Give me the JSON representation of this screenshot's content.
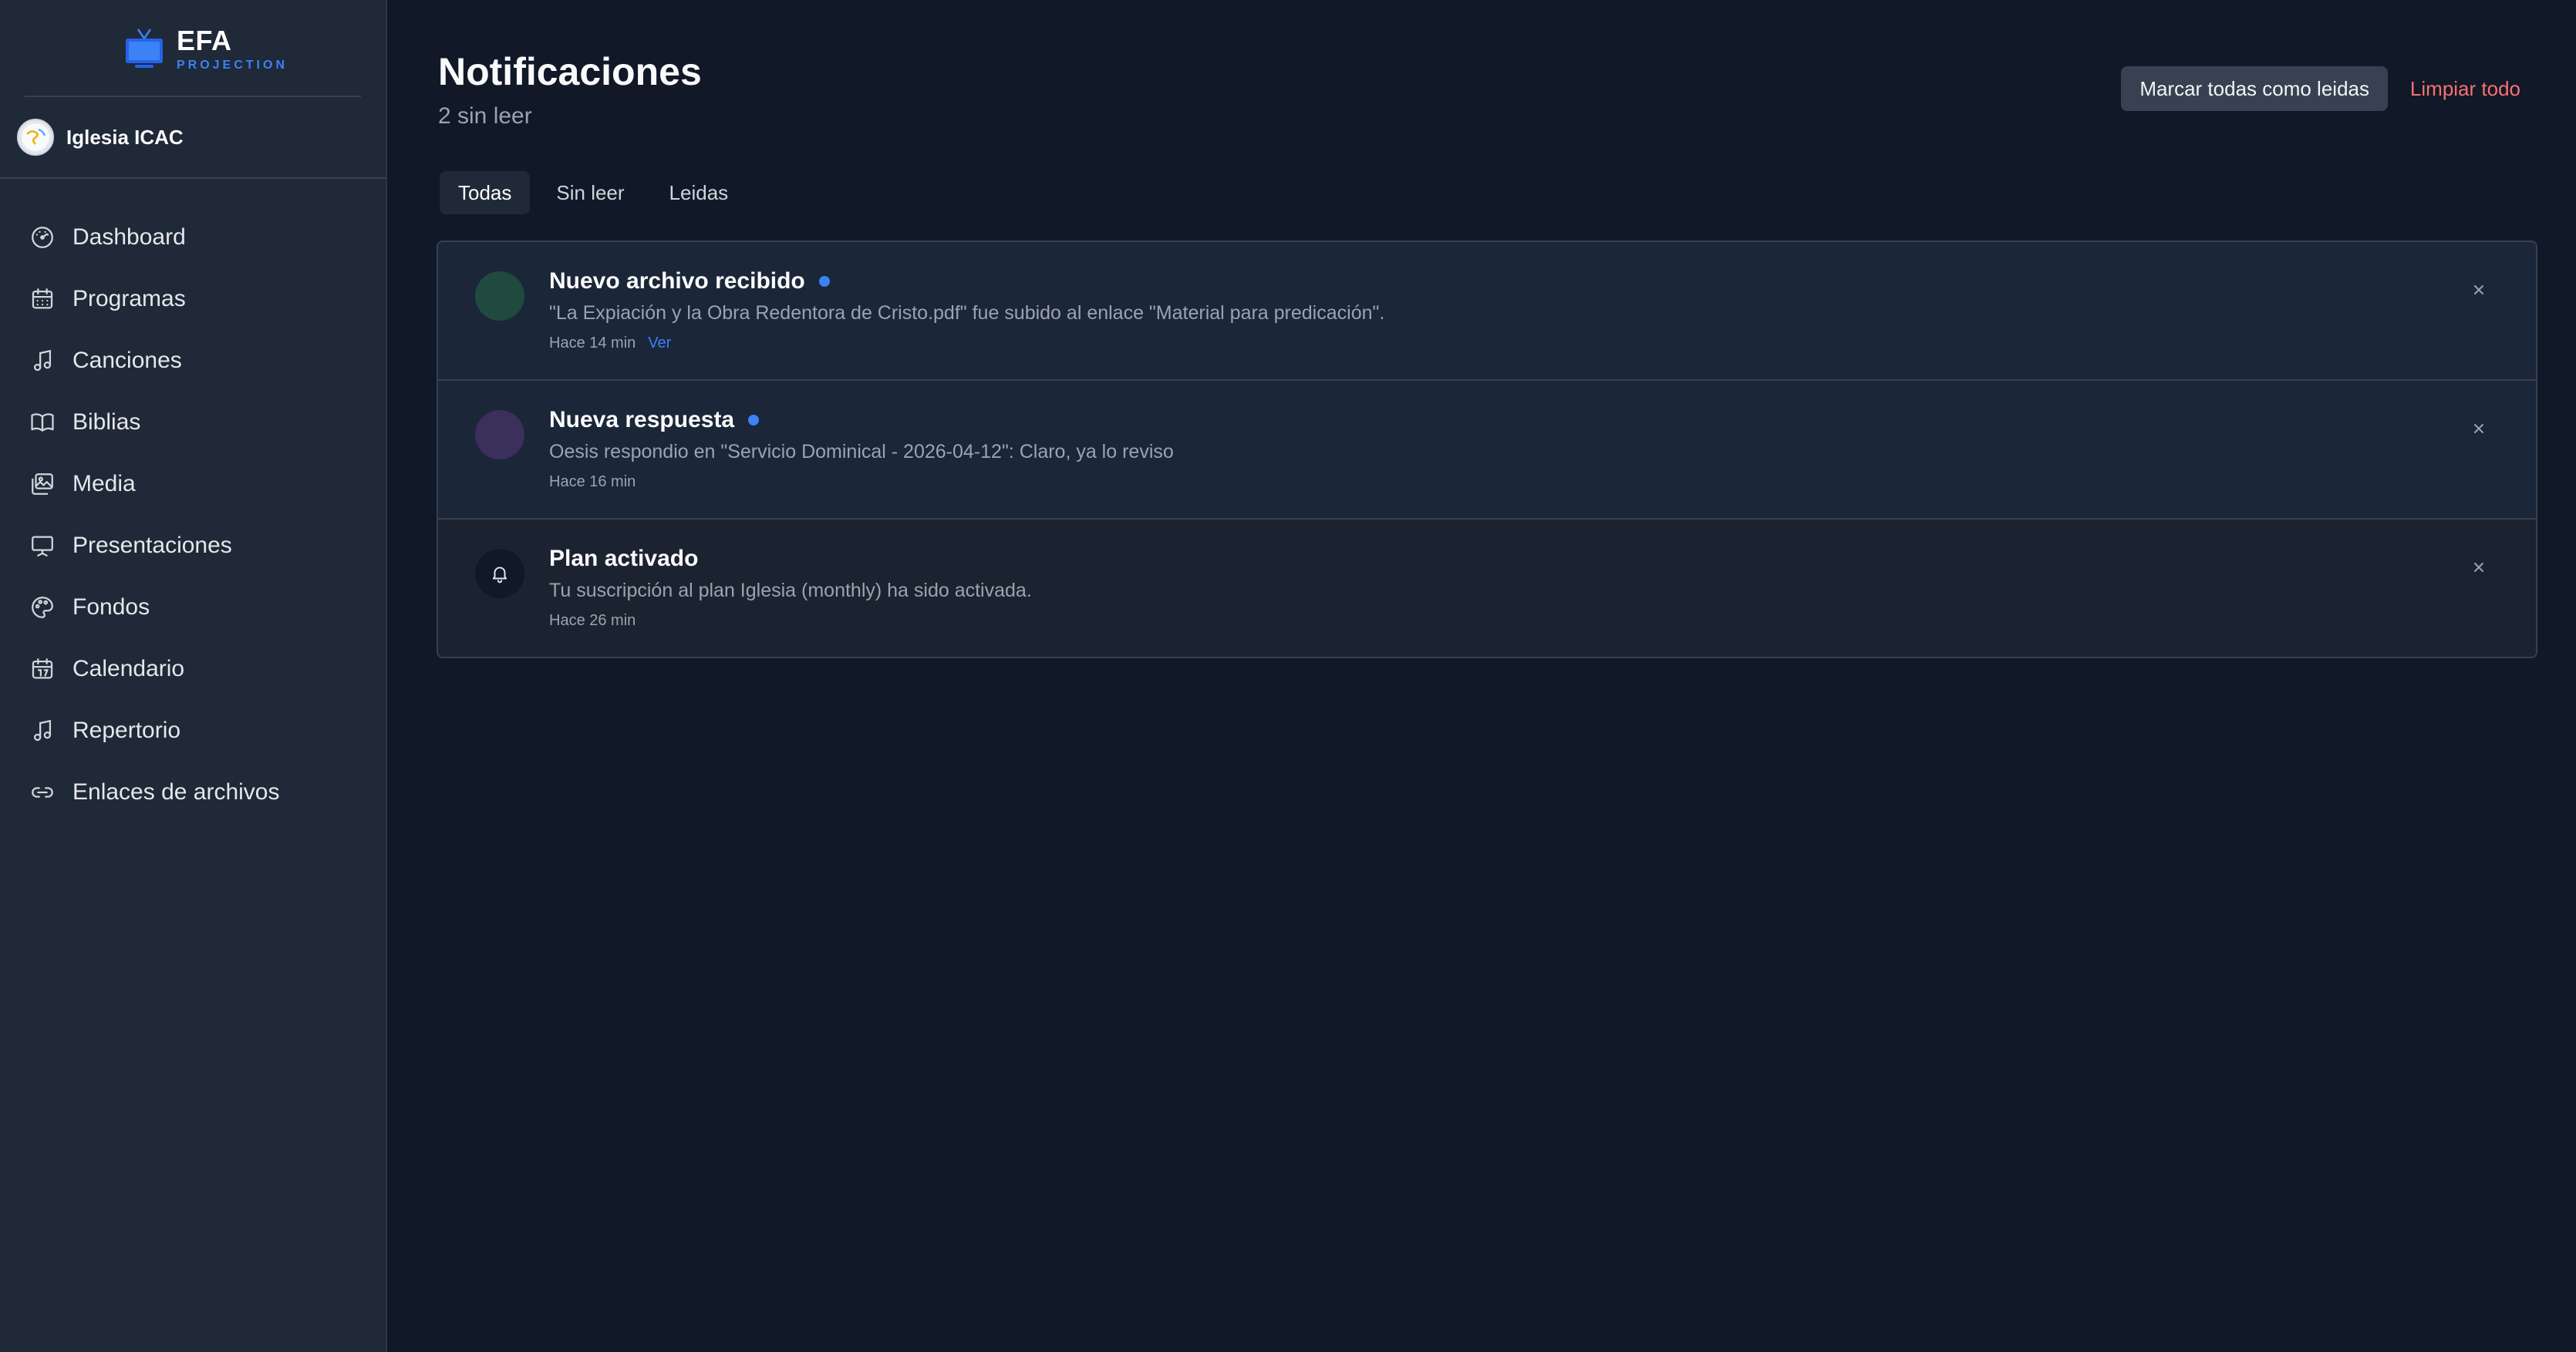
{
  "brand": {
    "name": "EFA",
    "sub": "PROJECTION"
  },
  "org": {
    "name": "Iglesia ICAC"
  },
  "nav": [
    {
      "label": "Dashboard",
      "icon": "gauge-icon"
    },
    {
      "label": "Programas",
      "icon": "calendar-grid-icon"
    },
    {
      "label": "Canciones",
      "icon": "music-note-icon"
    },
    {
      "label": "Biblias",
      "icon": "book-icon"
    },
    {
      "label": "Media",
      "icon": "images-icon"
    },
    {
      "label": "Presentaciones",
      "icon": "presentation-icon"
    },
    {
      "label": "Fondos",
      "icon": "palette-icon"
    },
    {
      "label": "Calendario",
      "icon": "calendar-icon"
    },
    {
      "label": "Repertorio",
      "icon": "music-note-icon"
    },
    {
      "label": "Enlaces de archivos",
      "icon": "link-icon"
    }
  ],
  "header": {
    "title": "Notificaciones",
    "unread": "2 sin leer",
    "mark_all": "Marcar todas como leidas",
    "clear_all": "Limpiar todo"
  },
  "tabs": [
    {
      "label": "Todas",
      "active": true
    },
    {
      "label": "Sin leer",
      "active": false
    },
    {
      "label": "Leidas",
      "active": false
    }
  ],
  "notifications": [
    {
      "title": "Nuevo archivo recibido",
      "body": "\"La Expiación y la Obra Redentora de Cristo.pdf\" fue subido al enlace \"Material para predicación\".",
      "time": "Hace 14 min",
      "link": "Ver",
      "unread": true,
      "icon_color": "#1f4a3d"
    },
    {
      "title": "Nueva respuesta",
      "body": "Oesis respondio en \"Servicio Dominical - 2026-04-12\": Claro, ya lo reviso",
      "time": "Hace 16 min",
      "link": "",
      "unread": true,
      "icon_color": "#3b2f5c"
    },
    {
      "title": "Plan activado",
      "body": "Tu suscripción al plan Iglesia (monthly) ha sido activada.",
      "time": "Hace 26 min",
      "link": "",
      "unread": false,
      "icon_color": "#111827"
    }
  ],
  "colors": {
    "accent": "#3b82f6",
    "danger": "#f87171",
    "background": "#111827",
    "sidebar": "#1f2937"
  }
}
